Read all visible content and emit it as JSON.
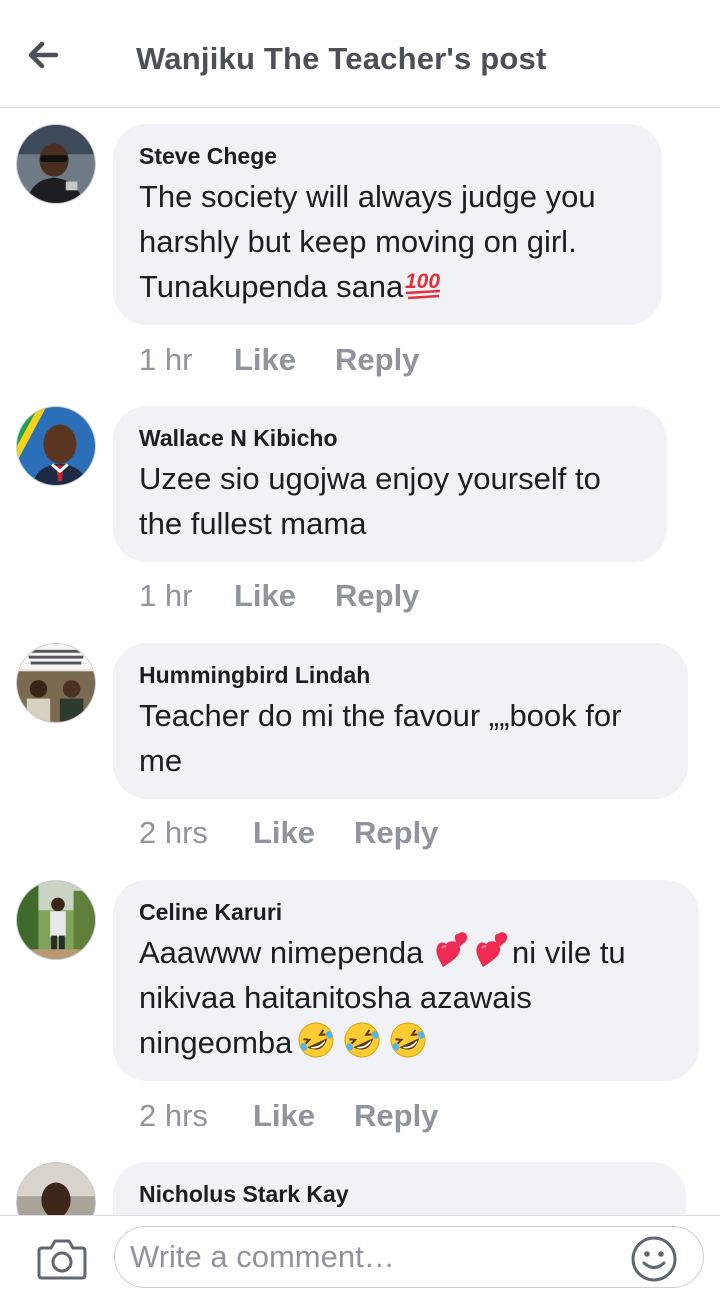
{
  "header": {
    "title": "Wanjiku The Teacher's post",
    "back_icon": "back-arrow-icon"
  },
  "comments": [
    {
      "author": "Steve Chege",
      "lines": [
        "The society will always judge you",
        "harshly but keep moving on girl.",
        "Tunakupenda sana"
      ],
      "trailing_emoji": [
        "hundred-points-icon"
      ],
      "time": "1 hr",
      "like": "Like",
      "reply": "Reply"
    },
    {
      "author": "Wallace N Kibicho",
      "lines": [
        "Uzee sio ugojwa enjoy yourself to",
        "the fullest mama"
      ],
      "time": "1 hr",
      "like": "Like",
      "reply": "Reply"
    },
    {
      "author": "Hummingbird Lindah",
      "lines": [
        "Teacher do mi the favour „„book for",
        "me"
      ],
      "time": "2 hrs",
      "like": "Like",
      "reply": "Reply"
    },
    {
      "author": "Celine Karuri",
      "lines": [
        "Aaawww nimependa ",
        "ni vile tu",
        "nikivaa haitanitosha azawais",
        "ningeomba"
      ],
      "inline_emoji": [
        "two-hearts-icon",
        "two-hearts-icon"
      ],
      "trailing_emoji": [
        "rolling-laughing-icon",
        "rolling-laughing-icon",
        "rolling-laughing-icon"
      ],
      "time": "2 hrs",
      "like": "Like",
      "reply": "Reply"
    },
    {
      "author": "Nicholus Stark Kay"
    }
  ],
  "composer": {
    "placeholder": "Write a comment…",
    "camera_icon": "camera-icon",
    "emoji_icon": "smiley-icon"
  },
  "colors": {
    "bubble": "#f0f2f5",
    "meta_text": "#90949c",
    "header_text": "#4b4f56",
    "divider": "#dadde1"
  }
}
